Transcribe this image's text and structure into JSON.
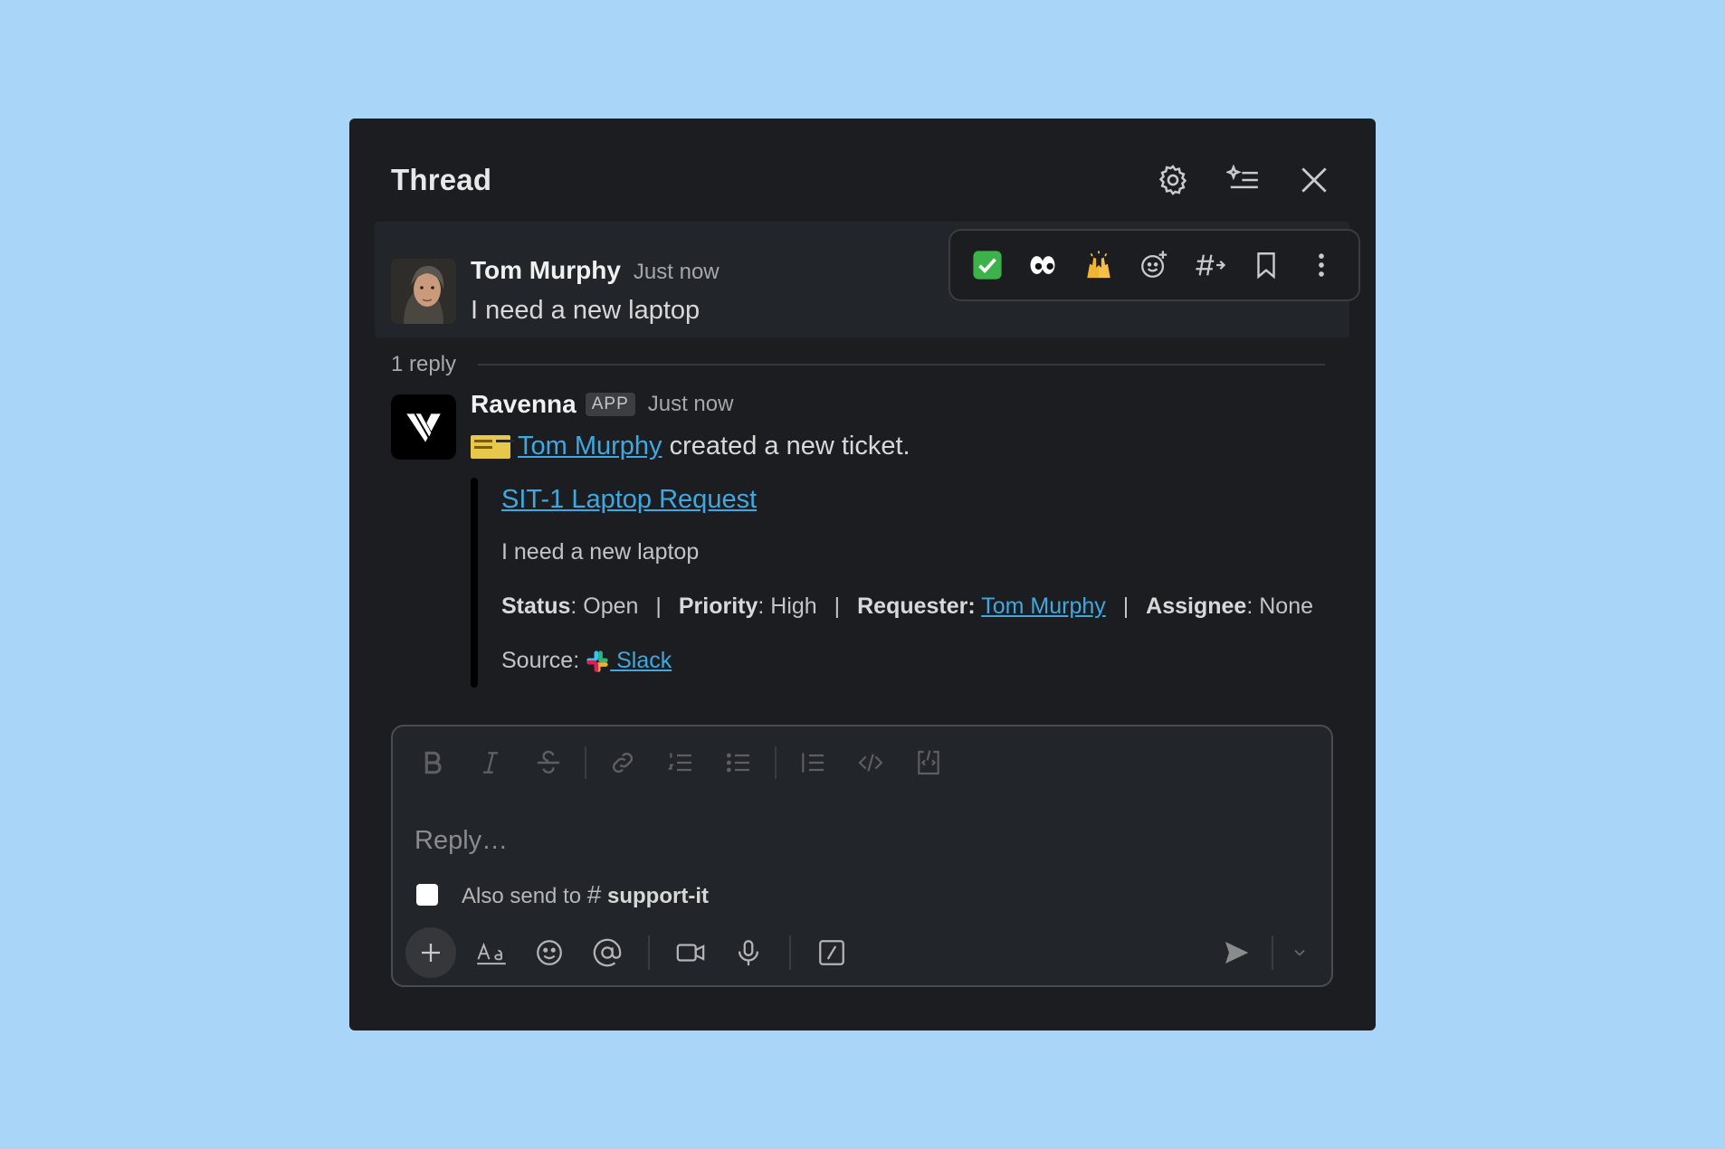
{
  "thread": {
    "title": "Thread",
    "settings_icon": "gear-icon",
    "summary_icon": "sparkle-list-icon",
    "close_icon": "close-icon"
  },
  "parent_message": {
    "author": "Tom Murphy",
    "time": "Just now",
    "text": "I need a new laptop"
  },
  "action_bar": {
    "reactions": [
      "✅",
      "👀",
      "🙌"
    ],
    "icons": [
      "add-reaction-icon",
      "forward-to-channel-icon",
      "bookmark-icon",
      "more-icon"
    ]
  },
  "replies": {
    "count_label": "1 reply"
  },
  "app_message": {
    "author": "Ravenna",
    "badge": "APP",
    "time": "Just now",
    "mention": "Tom Murphy",
    "text_suffix": " created a new ticket.",
    "attachment": {
      "title": "SIT-1 Laptop Request",
      "description": "I need a new laptop",
      "status_label": "Status",
      "status_value": ": Open",
      "priority_label": "Priority",
      "priority_value": ": High",
      "requester_label": "Requester:",
      "requester_value": "Tom Murphy",
      "assignee_label": "Assignee",
      "assignee_value": ": None",
      "separator": "|",
      "source_label": "Source:",
      "source_value": " Slack"
    }
  },
  "composer": {
    "placeholder": "Reply…",
    "also_send_prefix": "Also send to ",
    "channel_hash": "#",
    "channel_name": "support-it",
    "format_icons": [
      "bold-icon",
      "italic-icon",
      "strikethrough-icon",
      "link-icon",
      "ordered-list-icon",
      "bulleted-list-icon",
      "blockquote-icon",
      "code-icon",
      "code-block-icon"
    ],
    "bottom_icons": [
      "plus-icon",
      "text-format-icon",
      "emoji-icon",
      "mention-icon",
      "video-icon",
      "microphone-icon",
      "slash-command-icon",
      "send-icon",
      "chevron-down-icon"
    ]
  },
  "colors": {
    "background": "#a9d5f9",
    "panel": "#1b1d21",
    "link": "#3fa8e0"
  }
}
